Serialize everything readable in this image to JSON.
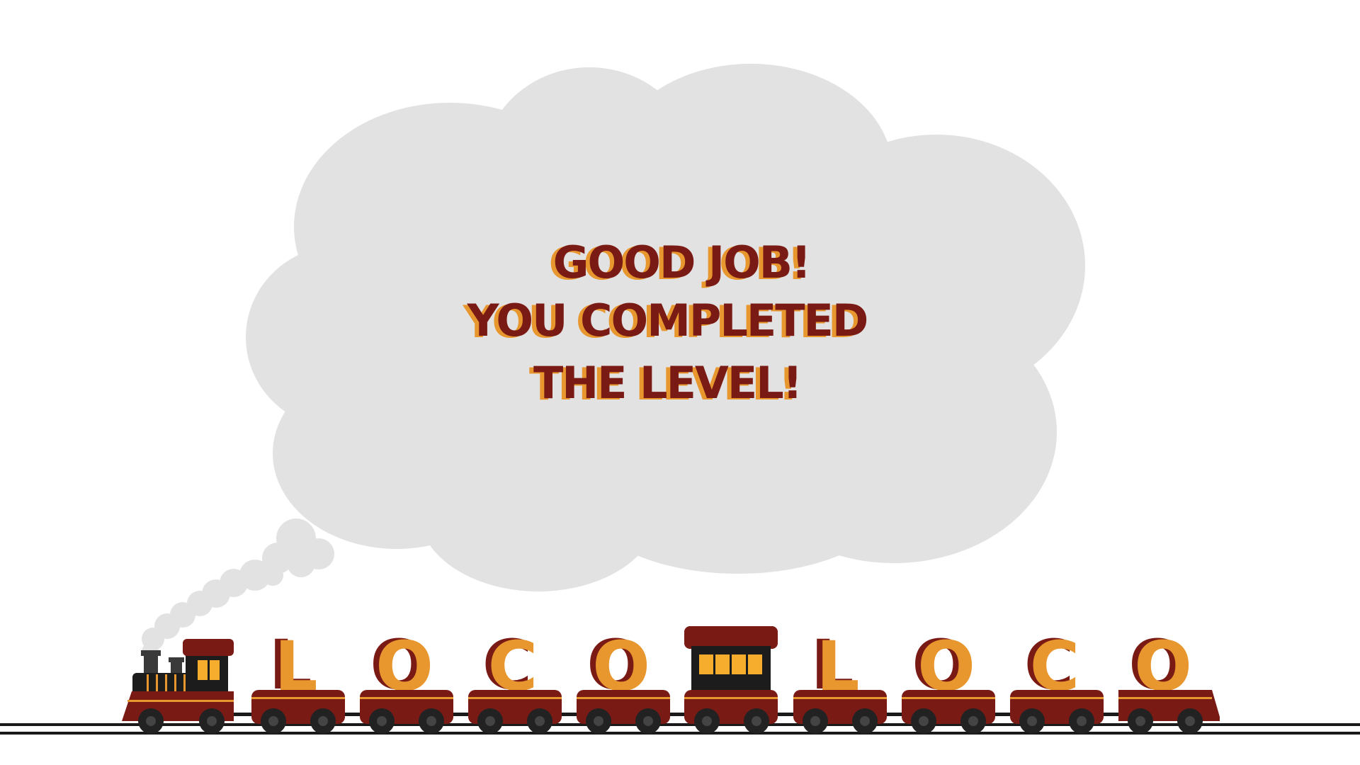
{
  "game": {
    "title_letters": [
      "L",
      "O",
      "C",
      "O",
      "L",
      "O",
      "C",
      "O"
    ],
    "message": {
      "line1": "GOOD JOB!",
      "line2": "YOU COMPLETED",
      "line3": "THE LEVEL!"
    }
  },
  "colors": {
    "background": "#ffffff",
    "cloud": "#e2e2e2",
    "message_front": "#7a1a14",
    "message_shadow": "#e8962e",
    "train_body": "#7a1a14",
    "train_trim": "#e8962e",
    "wheel": "#222222",
    "rail": "#1a1a1a",
    "letter_front": "#e8962e",
    "letter_shadow": "#7a1a14",
    "window": "#f6ad2e",
    "cab_dark": "#1c1c1c"
  },
  "icons": {
    "locomotive": "steam-locomotive-icon",
    "caboose": "passenger-car-icon",
    "smoke": "smoke-puff-icon"
  }
}
